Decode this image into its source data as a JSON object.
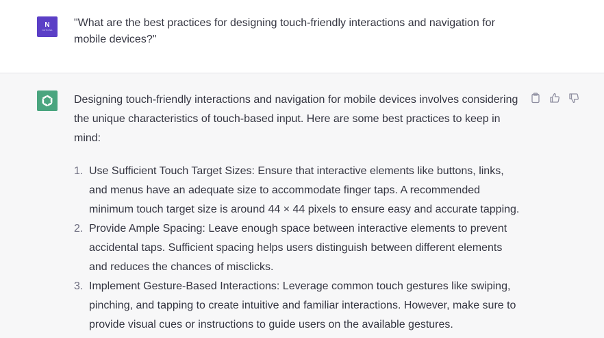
{
  "user_message": {
    "avatar_mark": "N",
    "avatar_subtext": "NOTIONS",
    "text": "\"What are the best practices for designing touch-friendly interactions and navigation for mobile devices?\""
  },
  "assistant_message": {
    "intro": "Designing touch-friendly interactions and navigation for mobile devices involves considering the unique characteristics of touch-based input. Here are some best practices to keep in mind:",
    "items": [
      {
        "number": "1.",
        "text": "Use Sufficient Touch Target Sizes: Ensure that interactive elements like buttons, links, and menus have an adequate size to accommodate finger taps. A recommended minimum touch target size is around 44 × 44 pixels to ensure easy and accurate tapping."
      },
      {
        "number": "2.",
        "text": "Provide Ample Spacing: Leave enough space between interactive elements to prevent accidental taps. Sufficient spacing helps users distinguish between different elements and reduces the chances of misclicks."
      },
      {
        "number": "3.",
        "text": "Implement Gesture-Based Interactions: Leverage common touch gestures like swiping, pinching, and tapping to create intuitive and familiar interactions. However, make sure to provide visual cues or instructions to guide users on the available gestures."
      }
    ],
    "actions": [
      {
        "icon": "clipboard-icon"
      },
      {
        "icon": "thumbs-up-icon"
      },
      {
        "icon": "thumbs-down-icon"
      }
    ]
  },
  "colors": {
    "user_avatar": "#5b3fc6",
    "assistant_avatar": "#4aa57f",
    "assistant_background": "#f7f7f8",
    "text": "#343541"
  }
}
